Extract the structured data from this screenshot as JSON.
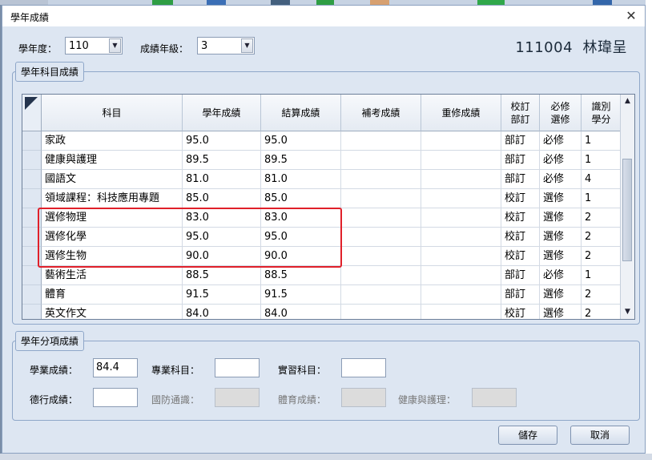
{
  "window": {
    "title": "學年成績",
    "close_glyph": "✕"
  },
  "filters": {
    "year_label": "學年度：",
    "year_value": "110",
    "grade_label": "成績年級：",
    "grade_value": "3"
  },
  "student": {
    "id": "111004",
    "name": "林瑋呈"
  },
  "subject_section": {
    "legend": "學年科目成績",
    "columns": [
      "科目",
      "學年成績",
      "結算成績",
      "補考成績",
      "重修成績",
      "校訂\n部訂",
      "必修\n選修",
      "識別\n學分"
    ],
    "rows": [
      [
        "家政",
        "95.0",
        "95.0",
        "",
        "",
        "部訂",
        "必修",
        "1"
      ],
      [
        "健康與護理",
        "89.5",
        "89.5",
        "",
        "",
        "部訂",
        "必修",
        "1"
      ],
      [
        "國語文",
        "81.0",
        "81.0",
        "",
        "",
        "部訂",
        "必修",
        "4"
      ],
      [
        "領域課程：科技應用專題",
        "85.0",
        "85.0",
        "",
        "",
        "校訂",
        "選修",
        "1"
      ],
      [
        "選修物理",
        "83.0",
        "83.0",
        "",
        "",
        "校訂",
        "選修",
        "2"
      ],
      [
        "選修化學",
        "95.0",
        "95.0",
        "",
        "",
        "校訂",
        "選修",
        "2"
      ],
      [
        "選修生物",
        "90.0",
        "90.0",
        "",
        "",
        "校訂",
        "選修",
        "2"
      ],
      [
        "藝術生活",
        "88.5",
        "88.5",
        "",
        "",
        "部訂",
        "必修",
        "1"
      ],
      [
        "體育",
        "91.5",
        "91.5",
        "",
        "",
        "部訂",
        "選修",
        "2"
      ],
      [
        "英文作文",
        "84.0",
        "84.0",
        "",
        "",
        "校訂",
        "選修",
        "2"
      ]
    ],
    "highlight_color": "#e0202a"
  },
  "category_section": {
    "legend": "學年分項成績",
    "academic_label": "學業成績：",
    "academic_value": "84.4",
    "professional_label": "專業科目：",
    "professional_value": "",
    "practical_label": "實習科目：",
    "practical_value": "",
    "conduct_label": "德行成績：",
    "conduct_value": "",
    "defense_label": "國防通識：",
    "defense_value": "",
    "pe_label": "體育成績：",
    "pe_value": "",
    "health_label": "健康與護理：",
    "health_value": ""
  },
  "actions": {
    "save_label": "儲存",
    "cancel_label": "取消"
  },
  "colors": {
    "dialog_bg": "#dde6f2",
    "border": "#8fa7c9",
    "header_bg": "#e4eaf2"
  }
}
